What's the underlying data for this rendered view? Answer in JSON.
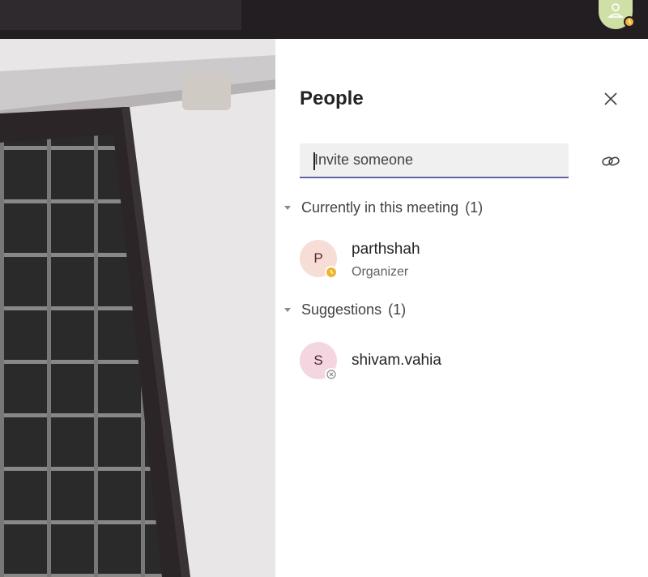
{
  "colors": {
    "accent": "#6264a7",
    "away_status": "#f0b530",
    "panel_bg": "#ffffff",
    "topbar_bg": "#231e22"
  },
  "topbar": {
    "me_avatar_icon": "person-icon",
    "me_status_icon": "away-clock-icon"
  },
  "panel": {
    "title": "People",
    "close_icon": "close-icon",
    "invite": {
      "placeholder": "Invite someone",
      "value": ""
    },
    "copy_link_icon": "link-icon",
    "sections": [
      {
        "label": "Currently in this meeting",
        "count": "(1)",
        "people": [
          {
            "initial": "P",
            "name": "parthshah",
            "role": "Organizer",
            "status": "away"
          }
        ]
      },
      {
        "label": "Suggestions",
        "count": "(1)",
        "people": [
          {
            "initial": "S",
            "name": "shivam.vahia",
            "status": "offline"
          }
        ]
      }
    ]
  }
}
